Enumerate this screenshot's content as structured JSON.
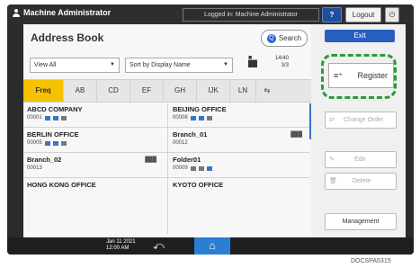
{
  "topbar": {
    "title": "Machine Administrator",
    "login_text": "Logged in: Machine Administrator",
    "help": "?",
    "logout": "Logout",
    "power": "⏻"
  },
  "header": {
    "title": "Address Book",
    "search": "Search"
  },
  "filters": {
    "view": "View All",
    "sort": "Sort by Display Name",
    "count_top": "14/40",
    "count_bottom": "3/3"
  },
  "tabs": [
    "Freq",
    "AB",
    "CD",
    "EF",
    "GH",
    "IJK",
    "LN"
  ],
  "entries": [
    {
      "name": "ABCD COMPANY",
      "number": "00001",
      "group": ""
    },
    {
      "name": "BEIJING OFFICE",
      "number": "00008",
      "group": ""
    },
    {
      "name": "BERLIN OFFICE",
      "number": "00005",
      "group": ""
    },
    {
      "name": "Branch_01",
      "number": "00012",
      "group": "███"
    },
    {
      "name": "Branch_02",
      "number": "00013",
      "group": "███"
    },
    {
      "name": "Folder01",
      "number": "00009",
      "group": ""
    },
    {
      "name": "HONG KONG OFFICE",
      "number": "",
      "group": ""
    },
    {
      "name": "KYOTO OFFICE",
      "number": "",
      "group": ""
    }
  ],
  "side": {
    "exit": "Exit",
    "register": "Register",
    "change_order": "Change Order",
    "edit": "Edit",
    "delete": "Delete",
    "management": "Management"
  },
  "bottombar": {
    "date": "Jan 11 2021",
    "time": "12:00 AM"
  },
  "caption": "DOCSPA5315"
}
